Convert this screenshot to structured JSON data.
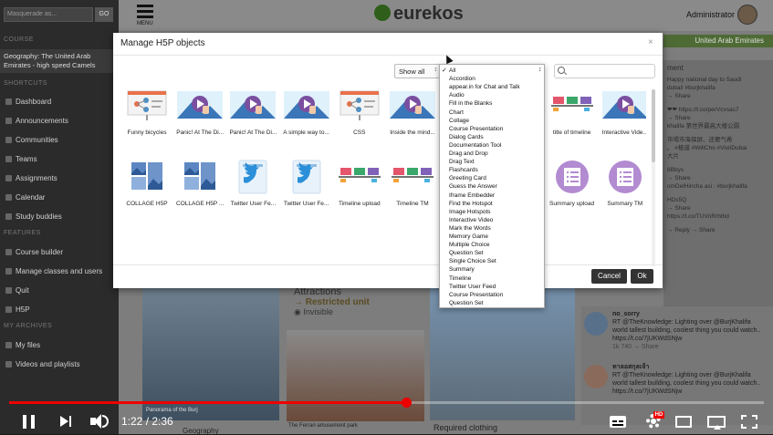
{
  "sidebar": {
    "masquerade_placeholder": "Masquerade as...",
    "masquerade_go": "GO",
    "section_course": "COURSE",
    "course_name": "Geography: The United Arab Emirates - high speed Camels",
    "section_shortcuts": "SHORTCUTS",
    "shortcuts": [
      "Dashboard",
      "Announcements",
      "Communities",
      "Teams",
      "Assignments",
      "Calendar",
      "Study buddies"
    ],
    "section_features": "FEATURES",
    "features": [
      "Course builder",
      "Manage classes and users",
      "Quit",
      "H5P"
    ],
    "section_archives": "MY ARCHIVES",
    "archives": [
      "My files",
      "Videos and playlists"
    ]
  },
  "header": {
    "menu_label": "MENU",
    "logo": "eurekos",
    "user": "Administrator"
  },
  "background": {
    "location_banner": "United Arab Emirates",
    "feed_heading": "ment",
    "feed_lines": [
      "Happy national day to Saudi",
      "dubai! #burjkhalifa",
      "→ Share",
      "❤❤ https://t.co/perVcvsas7",
      "→ Share",
      "khalifa 第世界最高大楼公園",
      "市場市海保屏、还要气希",
      "。 #棱道 #WillCho #VisitDubai",
      "大片",
      "8Bbys",
      "→ Share",
      "omDelHincha asi : #burjkhalifa",
      "HDs5Q",
      "→ Share",
      "https://t.co/TUVnRrhthd",
      "→ Reply → Share"
    ],
    "feed_bottom": [
      {
        "name": "no_sorry",
        "text": "RT @TheKnowledge: Lighting over @BurjKhalifa world tallest building, coolest thing you could watch.. https://t.co/7jUKWdSNjw",
        "meta": "1k 740  → Share"
      },
      {
        "name": "ทาลอสกุลเจ้า",
        "text": "RT @TheKnowledge: Lighting over @BurjKhalifa world tallest building, coolest thing you could watch.. https://t.co/7jUKWdSNjw",
        "meta": ""
      }
    ],
    "attractions_title": "Attractions",
    "restricted": "→ Restricted unit",
    "invisible": "◉ Invisible",
    "caption_left": "Geography",
    "caption_mid": "The Ferrari amusement park",
    "caption_right": "Required clothing",
    "photo_caption_left": "Panorama of the Burj"
  },
  "modal": {
    "title": "Manage H5P objects",
    "close": "×",
    "filter_label": "Show all",
    "cancel": "Cancel",
    "ok": "Ok",
    "tiles": [
      {
        "label": "Funny bicycles",
        "kind": "presentation"
      },
      {
        "label": "Panic! At The Di...",
        "kind": "video"
      },
      {
        "label": "Panic! At The Di...",
        "kind": "video"
      },
      {
        "label": "A simple way to...",
        "kind": "video"
      },
      {
        "label": "CSS",
        "kind": "presentation"
      },
      {
        "label": "Inside the mind...",
        "kind": "video"
      },
      {
        "label": "",
        "kind": "blank"
      },
      {
        "label": "",
        "kind": "blank"
      },
      {
        "label": "title of timeline",
        "kind": "timeline"
      },
      {
        "label": "Interactive Vide...",
        "kind": "video"
      },
      {
        "label": "COLLAGE H5P",
        "kind": "collage"
      },
      {
        "label": "COLLAGE H5P ...",
        "kind": "collage"
      },
      {
        "label": "Twitter User Fe...",
        "kind": "twitter"
      },
      {
        "label": "Twitter User Fe...",
        "kind": "twitter"
      },
      {
        "label": "Timeline upload",
        "kind": "timeline"
      },
      {
        "label": "Timeline TM",
        "kind": "timeline"
      },
      {
        "label": "",
        "kind": "blank"
      },
      {
        "label": "",
        "kind": "blank"
      },
      {
        "label": "Summary upload",
        "kind": "summary"
      },
      {
        "label": "Summary TM",
        "kind": "summary"
      }
    ]
  },
  "dropdown": {
    "selected": "All",
    "check": "✓",
    "options": [
      "All",
      "Accordion",
      "appear.in for Chat and Talk",
      "Audio",
      "Fill in the Blanks",
      "Chart",
      "Collage",
      "Course Presentation",
      "Dialog Cards",
      "Documentation Tool",
      "Drag and Drop",
      "Drag Text",
      "Flashcards",
      "Greeting Card",
      "Guess the Answer",
      "Iframe Embedder",
      "Find the Hotspot",
      "Image Hotspots",
      "Interactive Video",
      "Mark the Words",
      "Memory Game",
      "Multiple Choice",
      "Question Set",
      "Single Choice Set",
      "Summary",
      "Timeline",
      "Twitter User Feed",
      "Course Presentation",
      "Question Set"
    ]
  },
  "player": {
    "time_current": "1:22",
    "time_total": "2:36",
    "time_display": "1:22 / 2:36",
    "progress_fraction": 0.526,
    "hd_badge": "HD"
  },
  "colors": {
    "accent_red": "#ee0000",
    "brand_green": "#2e5e1a",
    "button_dark": "#333333"
  }
}
